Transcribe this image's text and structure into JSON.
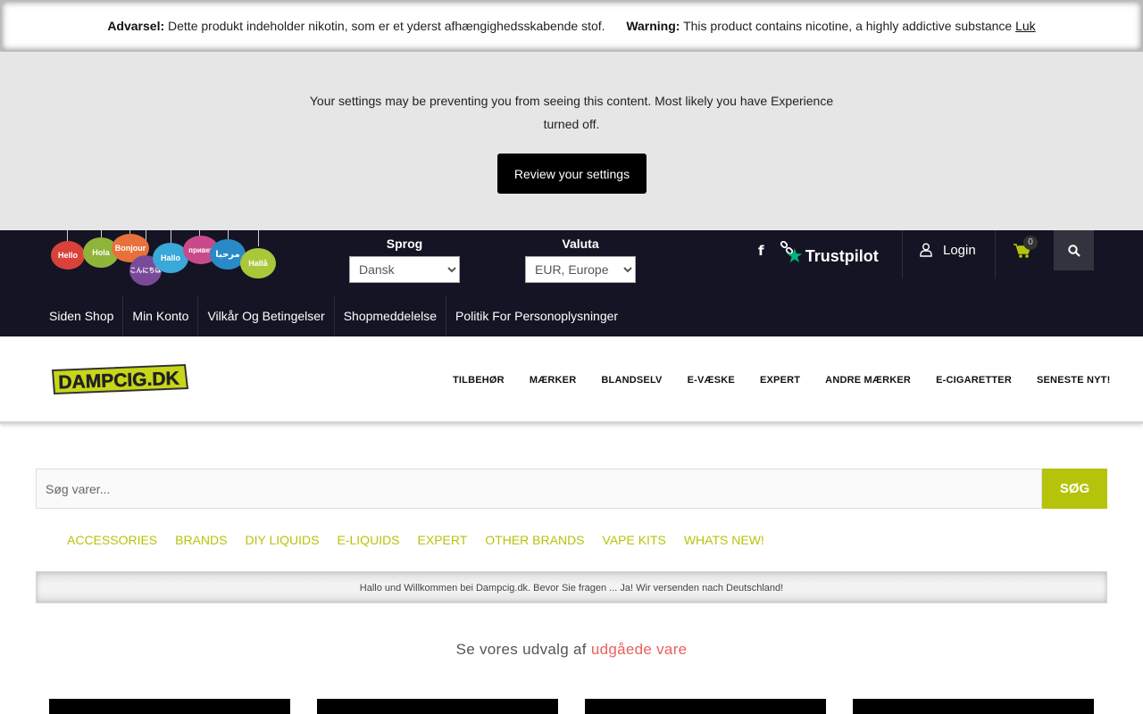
{
  "warning": {
    "da_label": "Advarsel:",
    "da_text": "Dette produkt indeholder nikotin, som er et yderst afhængighedsskabende stof.",
    "en_label": "Warning:",
    "en_text": "This product contains nicotine, a highly addictive substance",
    "close": "Luk"
  },
  "settings_notice": {
    "message": "Your settings may be preventing you from seeing this content. Most likely you have Experience turned off.",
    "button": "Review your settings"
  },
  "header": {
    "bubbles": [
      "Hello",
      "Hola",
      "Bonjour",
      "こんにちは",
      "Hallo",
      "привет",
      "مرحبا",
      "Hallå"
    ],
    "language": {
      "label": "Sprog",
      "selected": "Dansk"
    },
    "currency": {
      "label": "Valuta",
      "selected": "EUR, Europe"
    },
    "trustpilot": "Trustpilot",
    "login": "Login",
    "cart_count": "0"
  },
  "sub_nav": [
    "Siden Shop",
    "Min Konto",
    "Vilkår Og Betingelser",
    "Shopmeddelelse",
    "Politik For Personoplysninger"
  ],
  "logo_text": "DAMPCIG.DK",
  "main_nav": [
    "TILBEHØR",
    "MÆRKER",
    "BLANDSELV",
    "E-VÆSKE",
    "EXPERT",
    "ANDRE MÆRKER",
    "E-CIGARETTER",
    "SENESTE NYT!"
  ],
  "search": {
    "placeholder": "Søg varer...",
    "button": "SØG"
  },
  "categories": [
    "ACCESSORIES",
    "BRANDS",
    "DIY LIQUIDS",
    "E-LIQUIDS",
    "EXPERT",
    "OTHER BRANDS",
    "VAPE KITS",
    "WHATS NEW!"
  ],
  "welcome": "Hallo und Willkommen bei Dampcig.dk. Bevor Sie fragen ... Ja! Wir versenden nach Deutschland!",
  "discontinued": {
    "text": "Se vores udvalg af",
    "link": "udgåede vare"
  },
  "colors": {
    "accent": "#b5c40a",
    "dark": "#141424",
    "link_red": "#e8605e"
  }
}
